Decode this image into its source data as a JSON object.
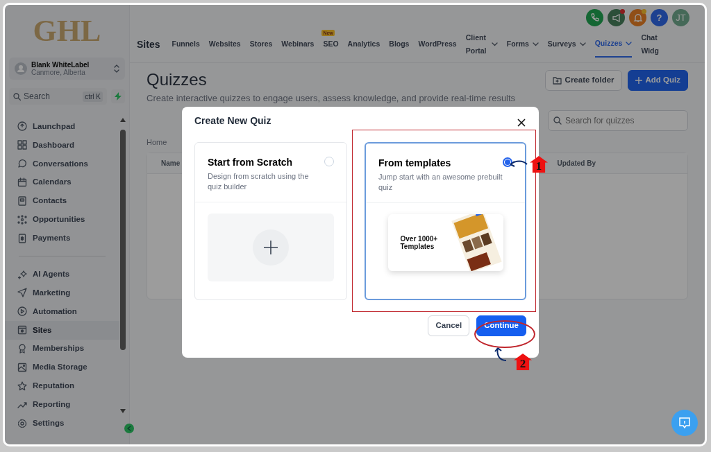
{
  "logo": "GHL",
  "account": {
    "name": "Blank WhiteLabel",
    "location": "Canmore, Alberta"
  },
  "sidebar_search": {
    "label": "Search",
    "shortcut": "ctrl K"
  },
  "sidebar": {
    "groups": [
      [
        {
          "label": "Launchpad",
          "selected": false
        },
        {
          "label": "Dashboard",
          "selected": false
        },
        {
          "label": "Conversations",
          "selected": false
        },
        {
          "label": "Calendars",
          "selected": false
        },
        {
          "label": "Contacts",
          "selected": false
        },
        {
          "label": "Opportunities",
          "selected": false
        },
        {
          "label": "Payments",
          "selected": false
        }
      ],
      [
        {
          "label": "AI Agents",
          "selected": false
        },
        {
          "label": "Marketing",
          "selected": false
        },
        {
          "label": "Automation",
          "selected": false
        },
        {
          "label": "Sites",
          "selected": true
        },
        {
          "label": "Memberships",
          "selected": false
        },
        {
          "label": "Media Storage",
          "selected": false
        },
        {
          "label": "Reputation",
          "selected": false
        },
        {
          "label": "Reporting",
          "selected": false
        }
      ]
    ],
    "settings": "Settings"
  },
  "header": {
    "section": "Sites",
    "tabs": [
      {
        "label": "Funnels",
        "selected": false,
        "dropdown": false
      },
      {
        "label": "Websites",
        "selected": false,
        "dropdown": false
      },
      {
        "label": "Stores",
        "selected": false,
        "dropdown": false
      },
      {
        "label": "Webinars",
        "selected": false,
        "dropdown": false
      },
      {
        "label": "SEO",
        "selected": false,
        "dropdown": false,
        "badge": "New"
      },
      {
        "label": "Analytics",
        "selected": false,
        "dropdown": false
      },
      {
        "label": "Blogs",
        "selected": false,
        "dropdown": false
      },
      {
        "label": "WordPress",
        "selected": false,
        "dropdown": false
      },
      {
        "label": "Client Portal",
        "selected": false,
        "dropdown": true
      },
      {
        "label": "Forms",
        "selected": false,
        "dropdown": true
      },
      {
        "label": "Surveys",
        "selected": false,
        "dropdown": true
      },
      {
        "label": "Quizzes",
        "selected": true,
        "dropdown": true
      },
      {
        "label": "Chat Widg",
        "selected": false,
        "dropdown": false
      }
    ],
    "help": "?",
    "avatar": "JT"
  },
  "page": {
    "title": "Quizzes",
    "subtitle": "Create interactive quizzes to engage users, assess knowledge, and provide real-time results",
    "buttons": [
      {
        "label": "Create folder",
        "kind": "secondary"
      },
      {
        "label": "Add Quiz",
        "kind": "primary"
      }
    ],
    "search": {
      "placeholder": "Search for quizzes"
    },
    "breadcrumb": "Home",
    "table": {
      "columns": [
        "Name",
        "Updated By"
      ]
    }
  },
  "modal": {
    "title": "Create New Quiz",
    "options": [
      {
        "kind": "blank",
        "title": "Start from Scratch",
        "description": "Design from scratch using the quiz builder",
        "selected": false
      },
      {
        "kind": "templates",
        "title": "From templates",
        "description": "Jump start with an awesome prebuilt quiz",
        "selected": true,
        "preview": "Over 1000+ Templates"
      }
    ],
    "buttons": [
      {
        "label": "Cancel",
        "kind": "secondary"
      },
      {
        "label": "Continue",
        "kind": "primary"
      }
    ]
  },
  "annotations": [
    {
      "number": "1"
    },
    {
      "number": "2"
    }
  ]
}
